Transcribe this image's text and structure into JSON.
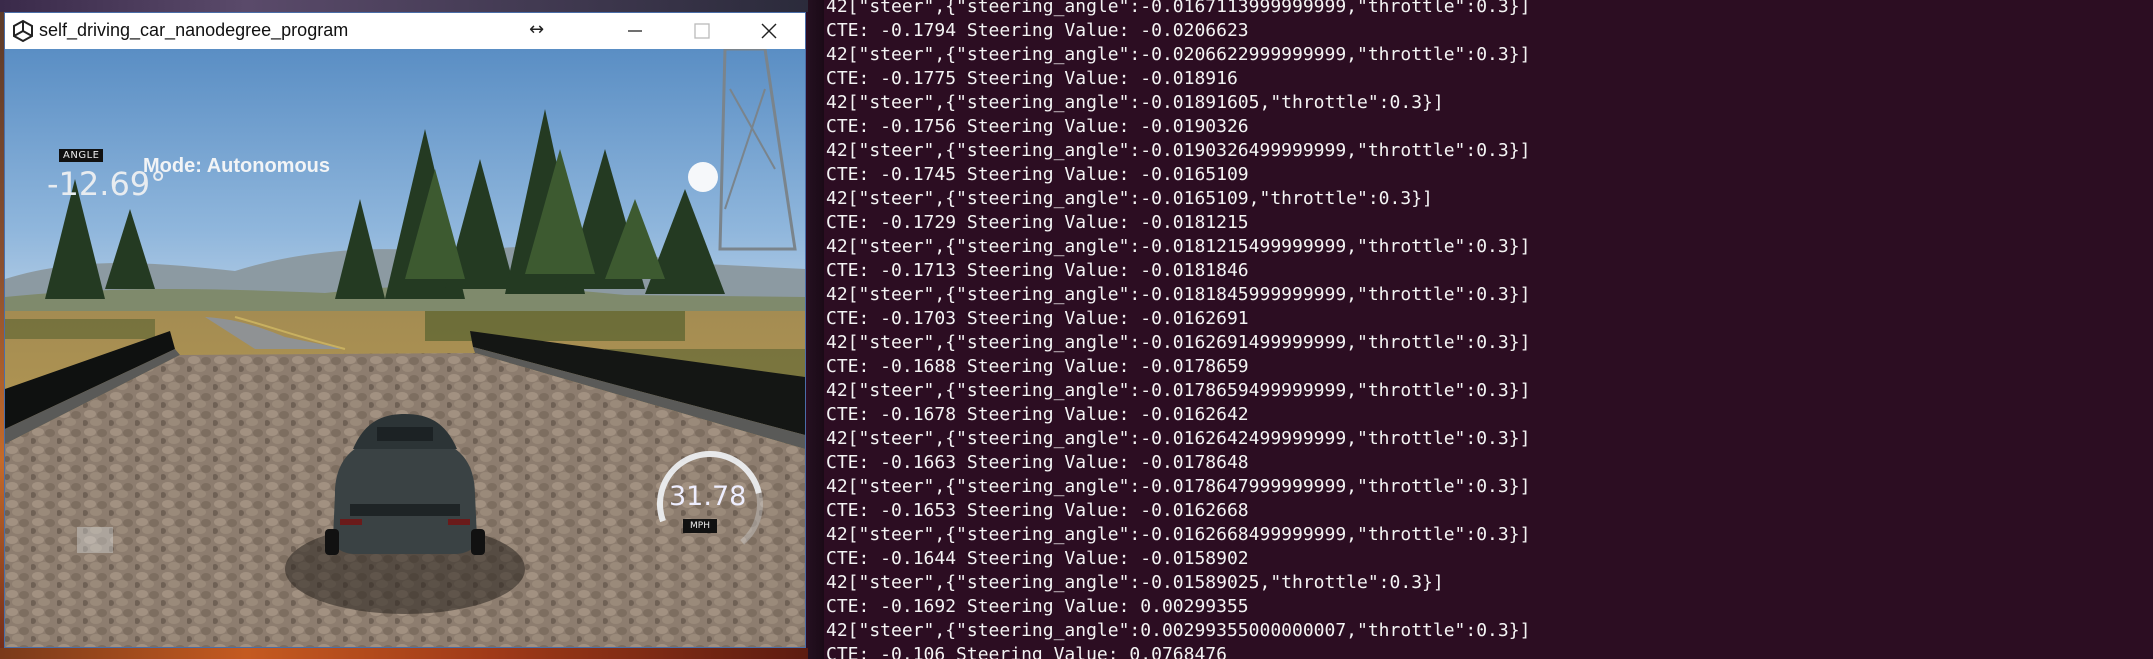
{
  "window": {
    "title": "self_driving_car_nanodegree_program",
    "app_icon": "unity-icon",
    "controls": [
      "move-icon",
      "minimize-icon",
      "maximize-icon",
      "close-icon"
    ]
  },
  "hud": {
    "angle_label": "ANGLE",
    "angle_value": "-12.69°",
    "mode": "Mode: Autonomous",
    "speed_value": "31.78",
    "speed_unit": "MPH",
    "speed_gauge_fraction": 0.75
  },
  "terminal": {
    "background": "#2c0d22",
    "lines": [
      "42[\"steer\",{\"steering_angle\":-0.0167113999999999,\"throttle\":0.3}]",
      "CTE: -0.1794 Steering Value: -0.0206623",
      "42[\"steer\",{\"steering_angle\":-0.0206622999999999,\"throttle\":0.3}]",
      "CTE: -0.1775 Steering Value: -0.018916",
      "42[\"steer\",{\"steering_angle\":-0.01891605,\"throttle\":0.3}]",
      "CTE: -0.1756 Steering Value: -0.0190326",
      "42[\"steer\",{\"steering_angle\":-0.0190326499999999,\"throttle\":0.3}]",
      "CTE: -0.1745 Steering Value: -0.0165109",
      "42[\"steer\",{\"steering_angle\":-0.0165109,\"throttle\":0.3}]",
      "CTE: -0.1729 Steering Value: -0.0181215",
      "42[\"steer\",{\"steering_angle\":-0.0181215499999999,\"throttle\":0.3}]",
      "CTE: -0.1713 Steering Value: -0.0181846",
      "42[\"steer\",{\"steering_angle\":-0.0181845999999999,\"throttle\":0.3}]",
      "CTE: -0.1703 Steering Value: -0.0162691",
      "42[\"steer\",{\"steering_angle\":-0.0162691499999999,\"throttle\":0.3}]",
      "CTE: -0.1688 Steering Value: -0.0178659",
      "42[\"steer\",{\"steering_angle\":-0.0178659499999999,\"throttle\":0.3}]",
      "CTE: -0.1678 Steering Value: -0.0162642",
      "42[\"steer\",{\"steering_angle\":-0.0162642499999999,\"throttle\":0.3}]",
      "CTE: -0.1663 Steering Value: -0.0178648",
      "42[\"steer\",{\"steering_angle\":-0.0178647999999999,\"throttle\":0.3}]",
      "CTE: -0.1653 Steering Value: -0.0162668",
      "42[\"steer\",{\"steering_angle\":-0.0162668499999999,\"throttle\":0.3}]",
      "CTE: -0.1644 Steering Value: -0.0158902",
      "42[\"steer\",{\"steering_angle\":-0.01589025,\"throttle\":0.3}]",
      "CTE: -0.1692 Steering Value: 0.00299355",
      "42[\"steer\",{\"steering_angle\":0.00299355000000007,\"throttle\":0.3}]",
      "CTE: -0.106 Steering Value: 0.0768476"
    ]
  }
}
